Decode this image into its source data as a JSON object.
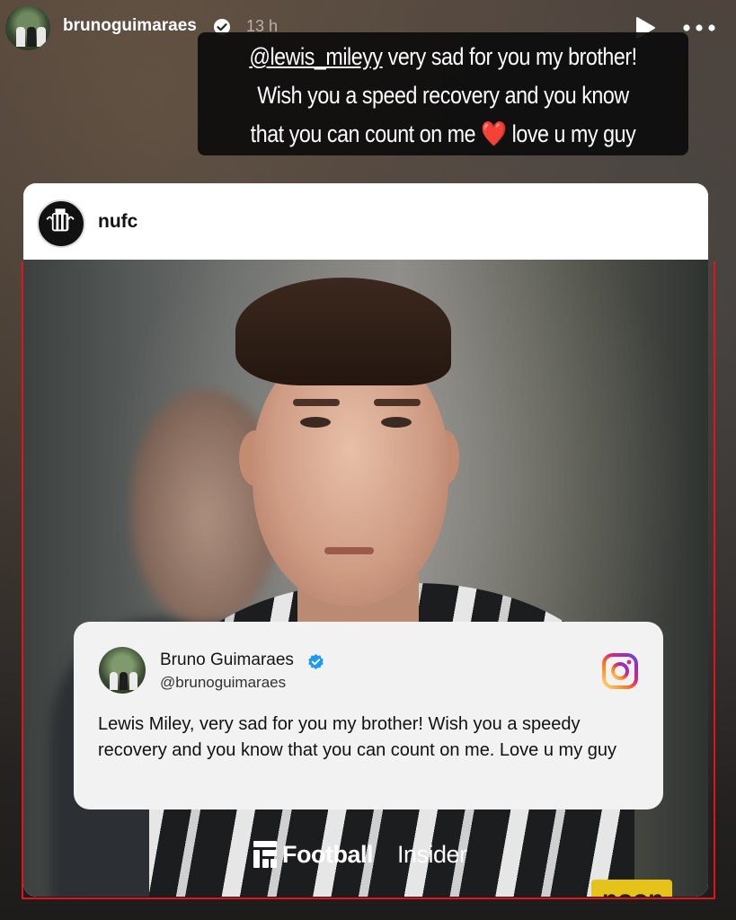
{
  "story": {
    "username": "brunoguimaraes",
    "time": "13 h"
  },
  "caption": {
    "mention": "@lewis_mileyy",
    "line1_rest": " very sad for you my brother!",
    "line2": "Wish you a speed recovery and you know",
    "line3_start": "that you can count on me ",
    "heart": "❤️",
    "line3_end": " love u my guy"
  },
  "post": {
    "account": "nufc",
    "sponsor_text": "noon"
  },
  "quote": {
    "name": "Bruno Guimaraes",
    "handle": "@brunoguimaraes",
    "text": "Lewis Miley, very sad for you my brother! Wish you a speedy recovery and you know that you can count on me. Love u my guy"
  },
  "brand": {
    "bold": "Football",
    "light": "Insider"
  },
  "colors": {
    "frame": "#e1131c",
    "verified": "#1d9bf0",
    "heart": "#e8202a"
  },
  "icons": [
    "verified-icon",
    "play-icon",
    "more-icon",
    "instagram-icon",
    "football-insider-logo-icon"
  ]
}
